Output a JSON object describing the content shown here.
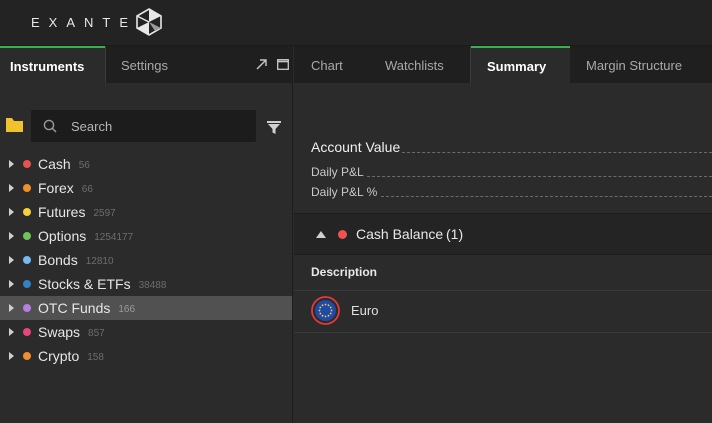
{
  "header": {
    "logo_text": "EXANTE",
    "logo_icon": "exante-logo-icon"
  },
  "left_panel": {
    "tabs": [
      {
        "label": "Instruments",
        "active": true
      },
      {
        "label": "Settings",
        "active": false
      }
    ],
    "window_icons": [
      "popout-icon",
      "maximize-icon"
    ],
    "folder_icon": "folder-icon",
    "search": {
      "placeholder": "Search",
      "value": ""
    },
    "filter_icon": "filter-icon",
    "tree": [
      {
        "label": "Cash",
        "count": "56",
        "color": "#e85151"
      },
      {
        "label": "Forex",
        "count": "66",
        "color": "#f0902a"
      },
      {
        "label": "Futures",
        "count": "2597",
        "color": "#f2d23a"
      },
      {
        "label": "Options",
        "count": "1254177",
        "color": "#6ec45a"
      },
      {
        "label": "Bonds",
        "count": "12810",
        "color": "#74b9f0"
      },
      {
        "label": "Stocks & ETFs",
        "count": "38488",
        "color": "#2f82c6"
      },
      {
        "label": "OTC Funds",
        "count": "166",
        "color": "#b57fe0",
        "selected": true
      },
      {
        "label": "Swaps",
        "count": "857",
        "color": "#e8457a"
      },
      {
        "label": "Crypto",
        "count": "158",
        "color": "#f0902a"
      }
    ]
  },
  "right_panel": {
    "tabs": [
      {
        "label": "Chart",
        "active": false
      },
      {
        "label": "Watchlists",
        "active": false
      },
      {
        "label": "Summary",
        "active": true
      },
      {
        "label": "Margin Structure",
        "active": false
      }
    ],
    "summary": {
      "account_value_label": "Account Value",
      "daily_pnl_label": "Daily P&L",
      "daily_pnl_pct_label": "Daily P&L %",
      "cash_balance_label": "Cash Balance",
      "cash_balance_count": "(1)",
      "column_header": "Description",
      "rows": [
        {
          "description": "Euro",
          "icon": "euro-flag-icon"
        }
      ]
    }
  },
  "colors": {
    "accent_green": "#37b24d",
    "cash_red": "#ef5350"
  }
}
